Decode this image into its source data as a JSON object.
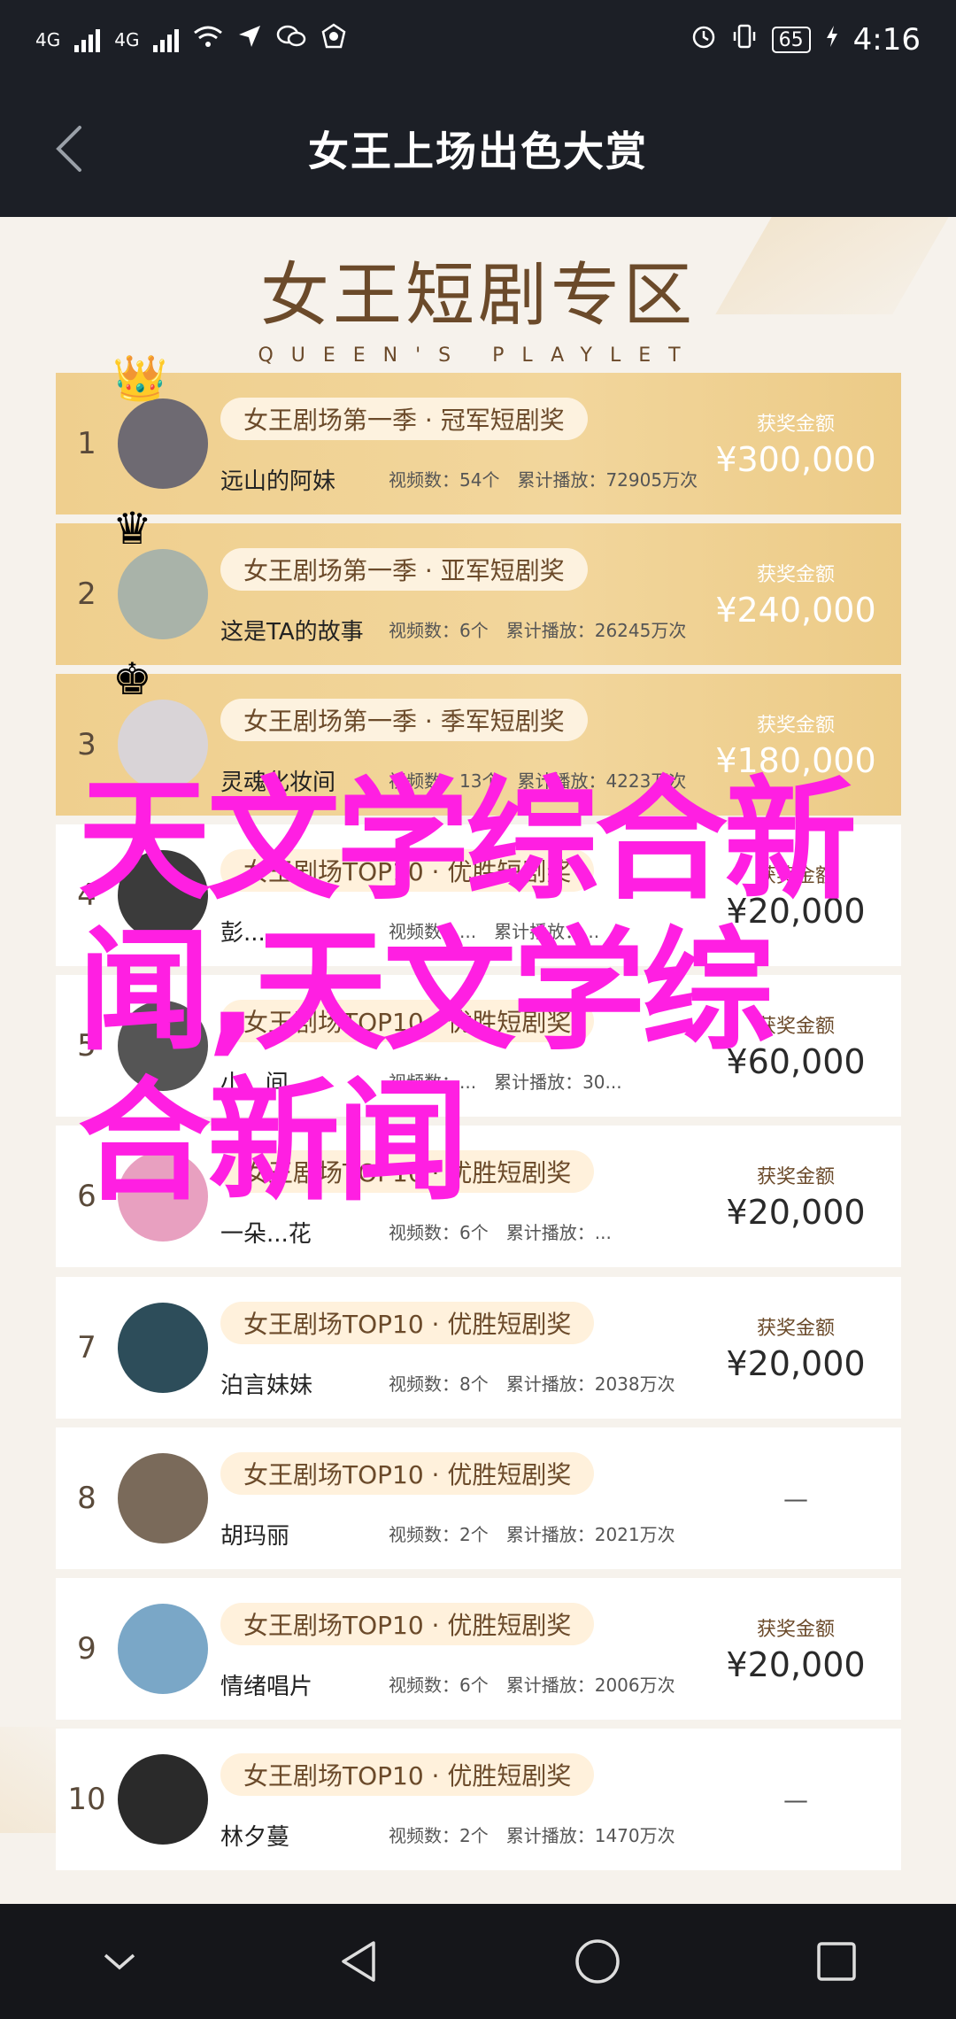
{
  "statusbar": {
    "left_signal_1": "4G",
    "left_signal_2": "4G",
    "battery": "65",
    "time": "4:16"
  },
  "header": {
    "title": "女王上场出色大赏"
  },
  "heading": {
    "title": "女王短剧专区",
    "subtitle": "QUEEN'S PLAYLET"
  },
  "labels": {
    "views_label": "视频数：",
    "plays_label": "累计播放：",
    "prize_label": "获奖金额"
  },
  "rows": [
    {
      "rank": "1",
      "award": "女王剧场第一季 · 冠军短剧奖",
      "name": "远山的阿妹",
      "views": "视频数：54个",
      "plays": "累计播放：72905万次",
      "prize_label": "获奖金额",
      "prize": "¥300,000",
      "avatar_color": "#6e6a72"
    },
    {
      "rank": "2",
      "award": "女王剧场第一季 · 亚军短剧奖",
      "name": "这是TA的故事",
      "views": "视频数：6个",
      "plays": "累计播放：26245万次",
      "prize_label": "获奖金额",
      "prize": "¥240,000",
      "avatar_color": "#a9b3a9"
    },
    {
      "rank": "3",
      "award": "女王剧场第一季 · 季军短剧奖",
      "name": "灵魂化妆间",
      "views": "视频数：13个",
      "plays": "累计播放：4223万次",
      "prize_label": "获奖金额",
      "prize": "¥180,000",
      "avatar_color": "#d9d4d7"
    },
    {
      "rank": "4",
      "award": "女王剧场TOP10 · 优胜短剧奖",
      "name": "彭...",
      "views": "视频数：...",
      "plays": "累计播放：...",
      "prize_label": "获奖金额",
      "prize": "¥20,000",
      "avatar_color": "#3b3b3b"
    },
    {
      "rank": "5",
      "award": "女王剧场TOP10 · 优胜短剧奖",
      "name": "小...间",
      "views": "视频数：...",
      "plays": "累计播放：30...",
      "prize_label": "获奖金额",
      "prize": "¥60,000",
      "avatar_color": "#555"
    },
    {
      "rank": "6",
      "award": "女王剧场TOP10 · 优胜短剧奖",
      "name": "一朵...花",
      "views": "视频数：6个",
      "plays": "累计播放：...",
      "prize_label": "获奖金额",
      "prize": "¥20,000",
      "avatar_color": "#e8a0c0"
    },
    {
      "rank": "7",
      "award": "女王剧场TOP10 · 优胜短剧奖",
      "name": "泊言妹妹",
      "views": "视频数：8个",
      "plays": "累计播放：2038万次",
      "prize_label": "获奖金额",
      "prize": "¥20,000",
      "avatar_color": "#2d4d5a"
    },
    {
      "rank": "8",
      "award": "女王剧场TOP10 · 优胜短剧奖",
      "name": "胡玛丽",
      "views": "视频数：2个",
      "plays": "累计播放：2021万次",
      "prize_label": "",
      "prize": "—",
      "avatar_color": "#7a6a5a"
    },
    {
      "rank": "9",
      "award": "女王剧场TOP10 · 优胜短剧奖",
      "name": "情绪唱片",
      "views": "视频数：6个",
      "plays": "累计播放：2006万次",
      "prize_label": "获奖金额",
      "prize": "¥20,000",
      "avatar_color": "#7aa7c7"
    },
    {
      "rank": "10",
      "award": "女王剧场TOP10 · 优胜短剧奖",
      "name": "林夕蔓",
      "views": "视频数：2个",
      "plays": "累计播放：1470万次",
      "prize_label": "",
      "prize": "—",
      "avatar_color": "#2a2a2a"
    }
  ],
  "overlay_text": "天文学综合新闻,天文学综合新闻",
  "colors": {
    "gold": "#efcf8e",
    "overlay": "#ff1fe2",
    "dark_bar": "#1c1f26"
  }
}
